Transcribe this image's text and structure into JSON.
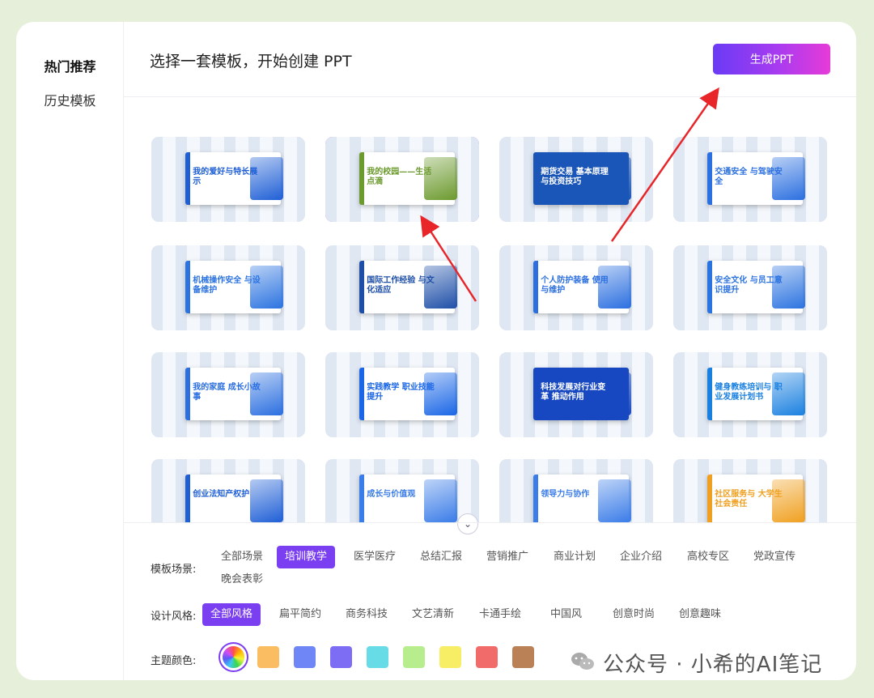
{
  "sidebar": {
    "items": [
      {
        "label": "热门推荐",
        "active": true
      },
      {
        "label": "历史模板",
        "active": false
      }
    ]
  },
  "header": {
    "title": "选择一套模板，开始创建 PPT",
    "generate_label": "生成PPT"
  },
  "templates": [
    {
      "title": "我的爱好与特长展示",
      "accent": "#1f5fd6",
      "dark": false,
      "selected": false
    },
    {
      "title": "我的校园——生活点滴",
      "accent": "#6c9a2e",
      "dark": false,
      "selected": true
    },
    {
      "title": "期货交易 基本原理与投资技巧",
      "accent": "#1a55b8",
      "dark": true,
      "selected": false
    },
    {
      "title": "交通安全 与驾驶安全",
      "accent": "#2b6fe0",
      "dark": false,
      "selected": false
    },
    {
      "title": "机械操作安全 与设备维护",
      "accent": "#2b73e0",
      "dark": false,
      "selected": false
    },
    {
      "title": "国际工作经验 与文化适应",
      "accent": "#1e4fa8",
      "dark": false,
      "selected": false
    },
    {
      "title": "个人防护装备 使用与维护",
      "accent": "#2b6fe0",
      "dark": false,
      "selected": false
    },
    {
      "title": "安全文化 与员工意识提升",
      "accent": "#2b73e0",
      "dark": false,
      "selected": false
    },
    {
      "title": "我的家庭 成长小故事",
      "accent": "#2b6fe0",
      "dark": false,
      "selected": false
    },
    {
      "title": "实践教学 职业技能提升",
      "accent": "#1a66e6",
      "dark": false,
      "selected": false
    },
    {
      "title": "科技发展对行业变革 推动作用",
      "accent": "#1748c2",
      "dark": true,
      "selected": false
    },
    {
      "title": "健身教练培训与 职业发展计划书",
      "accent": "#1a80e0",
      "dark": false,
      "selected": false
    },
    {
      "title": "创业法知产权护",
      "accent": "#1f5fd6",
      "dark": false,
      "selected": false
    },
    {
      "title": "成长与价值观",
      "accent": "#3a7ce8",
      "dark": false,
      "selected": false
    },
    {
      "title": "领导力与协作",
      "accent": "#3a7ce8",
      "dark": false,
      "selected": false
    },
    {
      "title": "社区服务与 大学生社会责任",
      "accent": "#f0a020",
      "dark": false,
      "selected": false
    }
  ],
  "filters": {
    "scene_label": "模板场景:",
    "scenes": [
      {
        "label": "全部场景",
        "active": false
      },
      {
        "label": "培训教学",
        "active": true
      },
      {
        "label": "医学医疗",
        "active": false
      },
      {
        "label": "总结汇报",
        "active": false
      },
      {
        "label": "营销推广",
        "active": false
      },
      {
        "label": "商业计划",
        "active": false
      },
      {
        "label": "企业介绍",
        "active": false
      },
      {
        "label": "高校专区",
        "active": false
      },
      {
        "label": "党政宣传",
        "active": false
      },
      {
        "label": "晚会表彰",
        "active": false
      }
    ],
    "style_label": "设计风格:",
    "styles": [
      {
        "label": "全部风格",
        "active": true
      },
      {
        "label": "扁平简约",
        "active": false
      },
      {
        "label": "商务科技",
        "active": false
      },
      {
        "label": "文艺清新",
        "active": false
      },
      {
        "label": "卡通手绘",
        "active": false
      },
      {
        "label": "中国风",
        "active": false
      },
      {
        "label": "创意时尚",
        "active": false
      },
      {
        "label": "创意趣味",
        "active": false
      }
    ],
    "color_label": "主题颜色:",
    "colors": [
      "rainbow",
      "#fbbd62",
      "#6f87f6",
      "#7d6cf4",
      "#67dbe6",
      "#b7ed8c",
      "#f7ee66",
      "#f26b6b",
      "#b98155"
    ]
  },
  "watermark": {
    "text": "公众号 · 小希的AI笔记"
  }
}
